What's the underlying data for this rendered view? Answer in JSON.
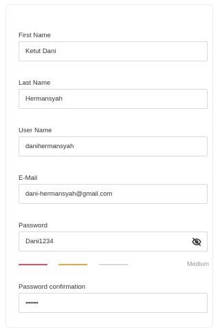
{
  "form": {
    "first_name": {
      "label": "First Name",
      "value": "Ketut Dani"
    },
    "last_name": {
      "label": "Last Name",
      "value": "Hermansyah"
    },
    "user_name": {
      "label": "User Name",
      "value": "danihermansyah"
    },
    "email": {
      "label": "E-Mail",
      "value": "dani-hermansyah@gmail.com"
    },
    "password": {
      "label": "Password",
      "value": "Dani1234",
      "visibility_icon": "eye-slash-icon",
      "strength_label": "Medium",
      "strength_colors": [
        "#e0525b",
        "#e5a740",
        "#d9d9d9"
      ]
    },
    "password_confirmation": {
      "label": "Password confirmation",
      "value": "••••••••"
    }
  }
}
